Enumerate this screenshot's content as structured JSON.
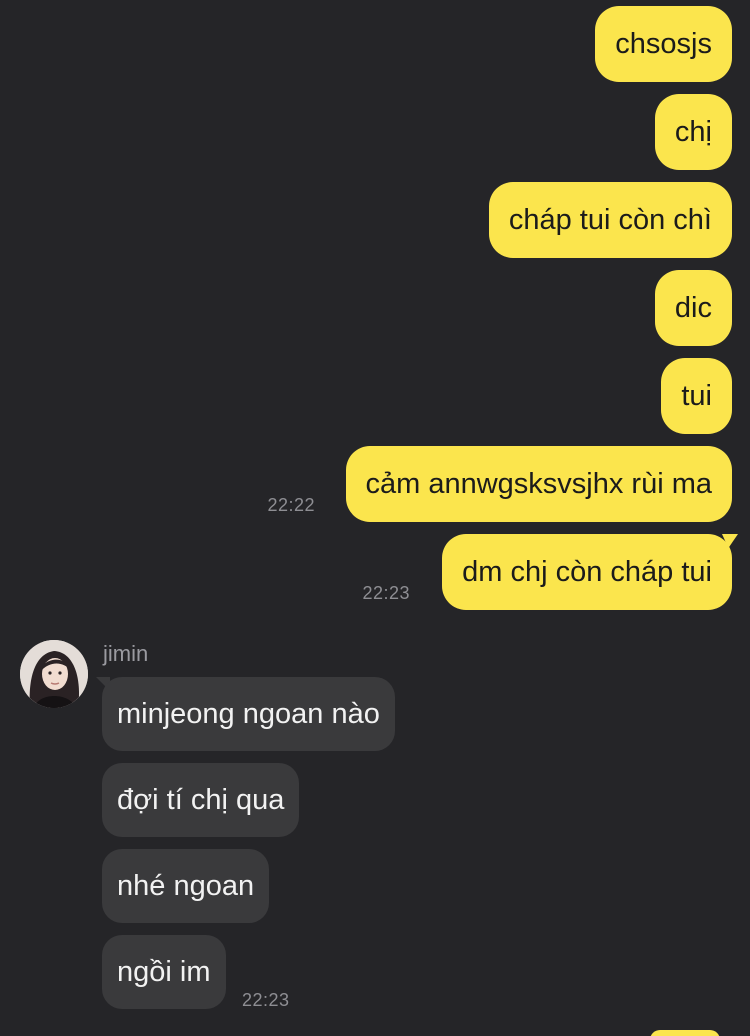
{
  "conversation": {
    "outgoing": [
      {
        "text": "chsosjs"
      },
      {
        "text": "chị"
      },
      {
        "text": "cháp tui còn chì"
      },
      {
        "text": "dic"
      },
      {
        "text": "tui"
      },
      {
        "text": "cảm annwgsksvsjhx rùi ma",
        "time": "22:22"
      },
      {
        "text": "dm chj còn cháp tui",
        "time": "22:23"
      }
    ],
    "incoming": {
      "sender": "jimin",
      "messages": [
        {
          "text": "minjeong ngoan nào"
        },
        {
          "text": "đợi tí chị qua"
        },
        {
          "text": "nhé ngoan"
        },
        {
          "text": "ngồi im",
          "time": "22:23"
        }
      ]
    }
  },
  "colors": {
    "background": "#252528",
    "outgoing_bubble": "#fbe54d",
    "incoming_bubble": "#3a3a3c",
    "timestamp": "#8e8e93"
  },
  "icons": {
    "avatar": "user-avatar-photo"
  }
}
